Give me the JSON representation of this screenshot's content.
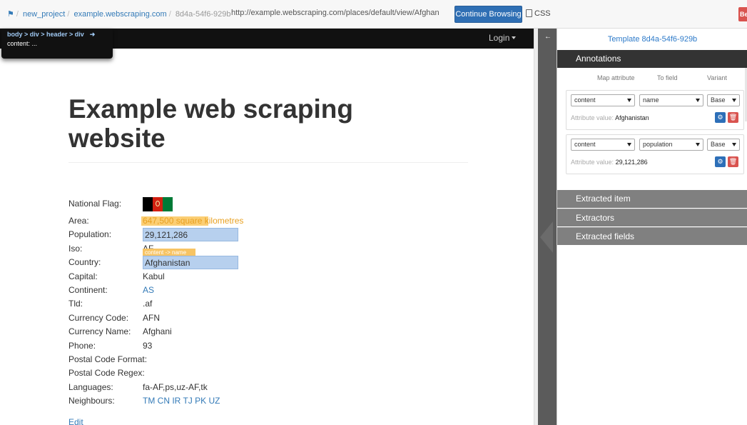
{
  "toolbar": {
    "home_icon": "home-icon",
    "crumb_project": "new_project",
    "crumb_site": "example.webscraping.com",
    "crumb_template": "8d4a-54f6-929b",
    "url": "http://example.webscraping.com/places/default/view/Afghan",
    "continue_label": "Continue Browsing",
    "css_label": "CSS",
    "red_tab_label": "Be"
  },
  "page": {
    "login_label": "Login",
    "popup_path": "body > div > header > div",
    "popup_content": "content: ...",
    "heading": "Example web scraping website",
    "details": [
      {
        "label": "National Flag:",
        "value": ""
      },
      {
        "label": "Area:",
        "value": "647,500 square kilometres"
      },
      {
        "label": "Population:",
        "value": "29,121,286"
      },
      {
        "label": "Iso:",
        "value": "AF"
      },
      {
        "label": "Country:",
        "value": "Afghanistan"
      },
      {
        "label": "Capital:",
        "value": "Kabul"
      },
      {
        "label": "Continent:",
        "value": "AS"
      },
      {
        "label": "Tld:",
        "value": ".af"
      },
      {
        "label": "Currency Code:",
        "value": "AFN"
      },
      {
        "label": "Currency Name:",
        "value": "Afghani"
      },
      {
        "label": "Phone:",
        "value": "93"
      },
      {
        "label": "Postal Code Format:",
        "value": ""
      },
      {
        "label": "Postal Code Regex:",
        "value": ""
      },
      {
        "label": "Languages:",
        "value": "fa-AF,ps,uz-AF,tk"
      },
      {
        "label": "Neighbours:",
        "value": "TM CN IR TJ PK UZ"
      }
    ],
    "iso_tag": "content -> name",
    "edit_label": "Edit"
  },
  "panel": {
    "template_title": "Template 8d4a-54f6-929b",
    "annotations_label": "Annotations",
    "col_map": "Map attribute",
    "col_field": "To field",
    "col_variant": "Variant",
    "annotations": [
      {
        "attr": "content",
        "field": "name",
        "variant": "Base",
        "attr_value_label": "Attribute value:",
        "attr_value": "Afghanistan"
      },
      {
        "attr": "content",
        "field": "population",
        "variant": "Base",
        "attr_value_label": "Attribute value:",
        "attr_value": "29,121,286"
      }
    ],
    "extracted_item_label": "Extracted item",
    "extractors_label": "Extractors",
    "extracted_fields_label": "Extracted fields"
  },
  "colors": {
    "accent": "#2f6fb4",
    "highlight_blue": "#b7d0ee",
    "highlight_yellow": "#f7c464",
    "danger": "#d9534f"
  }
}
